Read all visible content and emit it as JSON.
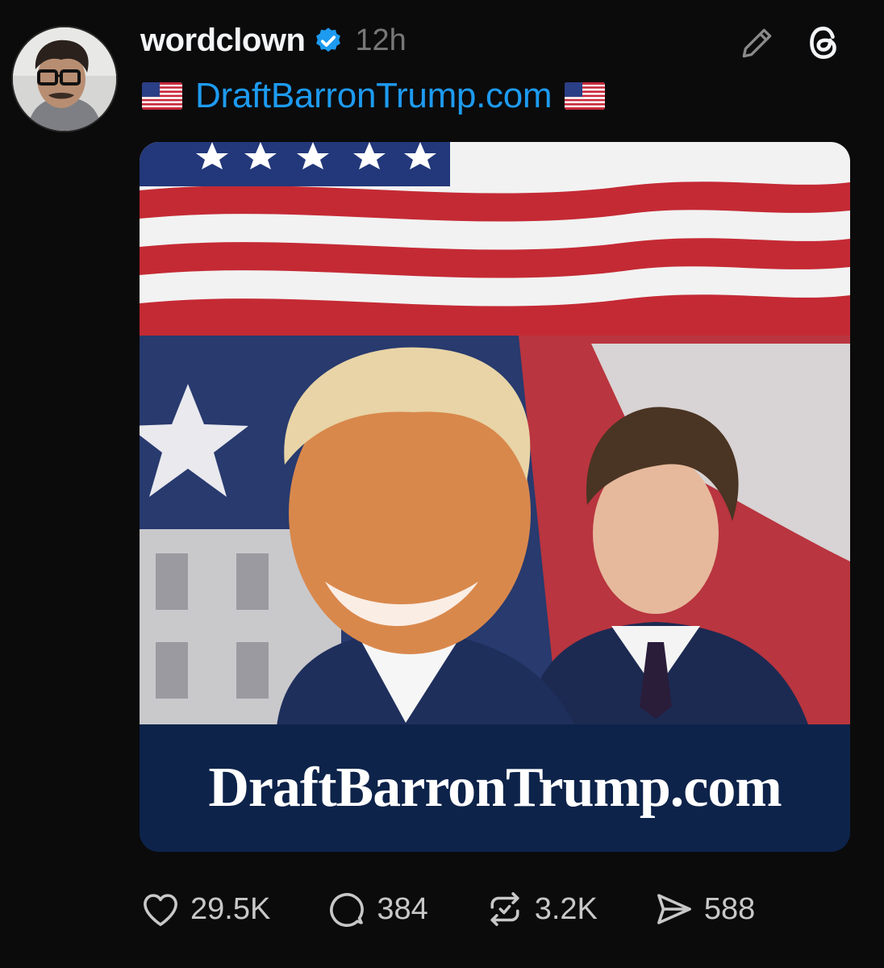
{
  "post": {
    "username": "wordclown",
    "timestamp": "12h",
    "verified": true,
    "text_emoji": "🇺🇸",
    "link_text": "DraftBarronTrump.com"
  },
  "media": {
    "caption": "DraftBarronTrump.com"
  },
  "stats": {
    "likes": "29.5K",
    "replies": "384",
    "reposts": "3.2K",
    "shares": "588"
  },
  "icons": {
    "verified": "verified-badge-icon",
    "edit": "pencil-icon",
    "app": "threads-logo-icon",
    "like": "heart-icon",
    "reply": "comment-bubble-icon",
    "repost": "repost-icon",
    "share": "send-icon"
  },
  "colors": {
    "background": "#0b0b0c",
    "link": "#1d9bf0",
    "verified": "#1d9bf0",
    "stat_text": "#c8c8c8",
    "timestamp": "#777777",
    "caption_bar": "#0d234a"
  }
}
